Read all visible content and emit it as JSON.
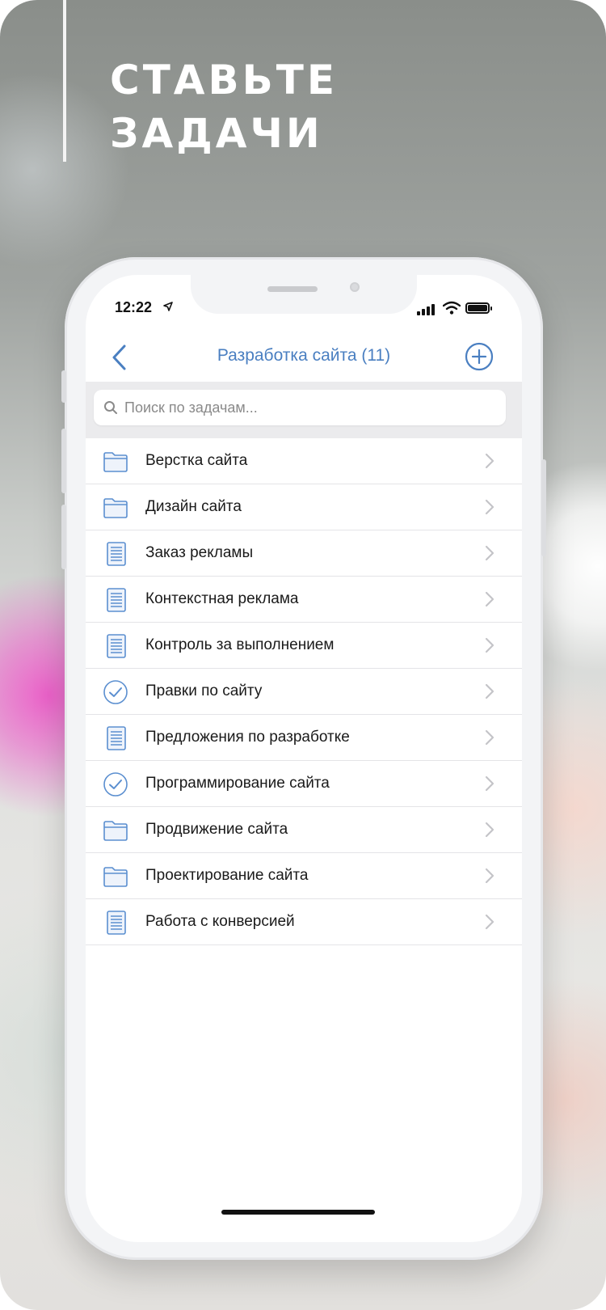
{
  "promo": {
    "headline_line1": "СТАВЬТЕ",
    "headline_line2": "ЗАДАЧИ"
  },
  "status_bar": {
    "time": "12:22",
    "location_icon": "location-arrow-icon",
    "signal_icon": "cellular-signal-icon",
    "wifi_icon": "wifi-icon",
    "battery_icon": "battery-icon"
  },
  "nav": {
    "back_icon": "chevron-left-icon",
    "title": "Разработка сайта (11)",
    "add_icon": "plus-circle-icon"
  },
  "search": {
    "placeholder": "Поиск по задачам..."
  },
  "tasks": [
    {
      "label": "Верстка сайта",
      "icon": "folder"
    },
    {
      "label": "Дизайн сайта",
      "icon": "folder"
    },
    {
      "label": "Заказ рекламы",
      "icon": "document"
    },
    {
      "label": "Контекстная реклама",
      "icon": "document"
    },
    {
      "label": "Контроль за выполнением",
      "icon": "document"
    },
    {
      "label": "Правки по сайту",
      "icon": "check"
    },
    {
      "label": "Предложения по разработке",
      "icon": "document"
    },
    {
      "label": "Программирование сайта",
      "icon": "check"
    },
    {
      "label": "Продвижение сайта",
      "icon": "folder"
    },
    {
      "label": "Проектирование сайта",
      "icon": "folder"
    },
    {
      "label": "Работа с конверсией",
      "icon": "document"
    }
  ],
  "colors": {
    "accent": "#4a7fc1",
    "icon_blue": "#5b8fd0",
    "separator": "#e4e4e7",
    "chevron": "#c4c4c8"
  }
}
